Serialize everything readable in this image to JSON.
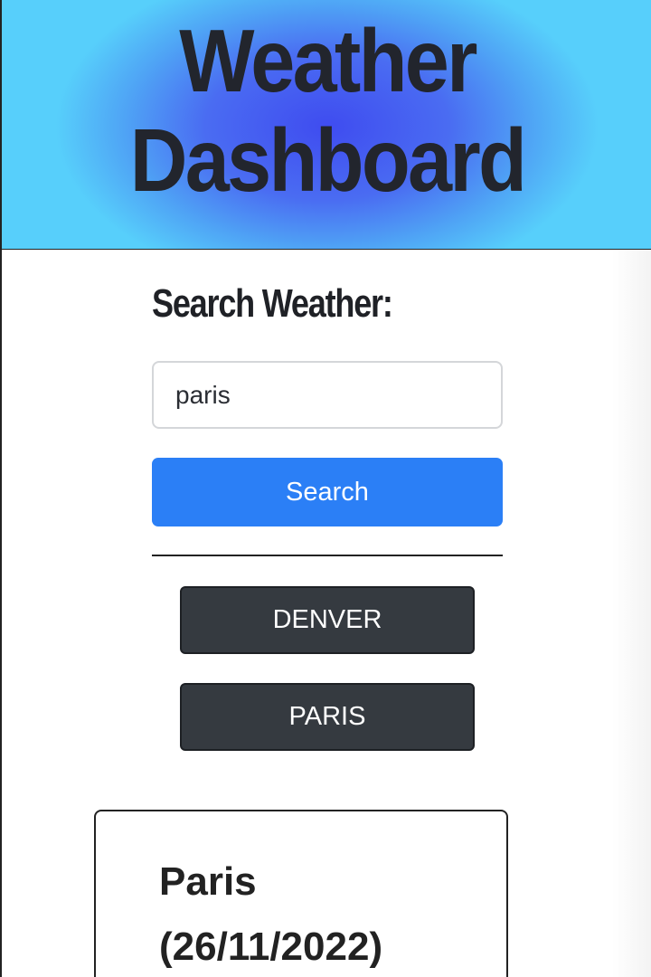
{
  "header": {
    "title_line1": "Weather",
    "title_line2": "Dashboard"
  },
  "search": {
    "heading": "Search Weather:",
    "input_value": "paris",
    "button_label": "Search"
  },
  "history": {
    "cities": [
      "DENVER",
      "PARIS"
    ]
  },
  "current_weather": {
    "city": "Paris",
    "date": "(26/11/2022)"
  },
  "colors": {
    "search_button": "#2b7ff6",
    "city_button": "#353a40",
    "header_center": "#3f4cf0",
    "header_edge": "#57cffb",
    "title_text": "#22252d"
  }
}
